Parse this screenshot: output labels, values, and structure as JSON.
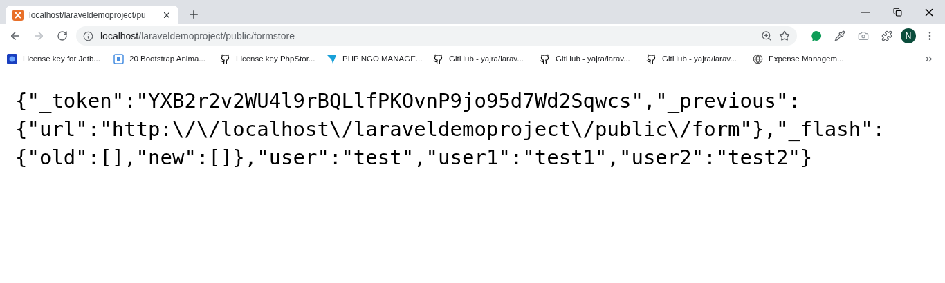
{
  "tabs": [
    {
      "title": "localhost/laraveldemoproject/pu",
      "selected": true
    }
  ],
  "address_bar": {
    "url_host": "localhost",
    "url_path": "/laraveldemoproject/public/formstore"
  },
  "profile": {
    "initial": "N"
  },
  "bookmarks": [
    {
      "label": "License key for Jetb...",
      "kind": "disc"
    },
    {
      "label": "20 Bootstrap Anima...",
      "kind": "square"
    },
    {
      "label": "License key PhpStor...",
      "kind": "github"
    },
    {
      "label": "PHP NGO MANAGE...",
      "kind": "bird"
    },
    {
      "label": "GitHub - yajra/larav...",
      "kind": "github"
    },
    {
      "label": "GitHub - yajra/larav...",
      "kind": "github"
    },
    {
      "label": "GitHub - yajra/larav...",
      "kind": "github"
    },
    {
      "label": "Expense Managem...",
      "kind": "globe"
    }
  ],
  "page_lines": [
    "{\"_token\":\"YXB2r2v2WU4l9rBQLlfPKOvnP9jo95d7Wd2Sqwcs\",\"_previous\":",
    "{\"url\":\"http:\\/\\/localhost\\/laraveldemoproject\\/public\\/form\"},\"_flash\":",
    "{\"old\":[],\"new\":[]},\"user\":\"test\",\"user1\":\"test1\",\"user2\":\"test2\"}"
  ]
}
